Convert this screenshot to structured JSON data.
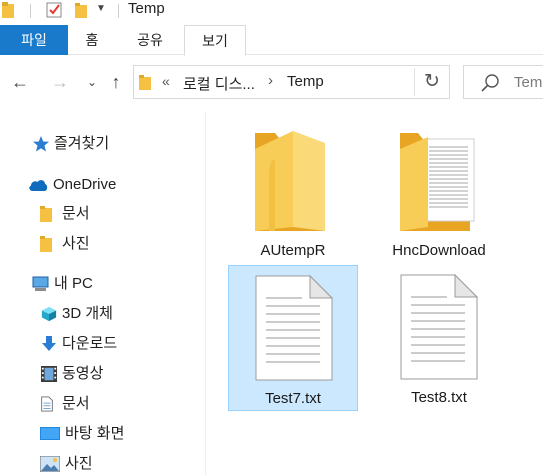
{
  "window": {
    "title": "Temp"
  },
  "ribbon": {
    "tabs": [
      {
        "label": "파일"
      },
      {
        "label": "홈"
      },
      {
        "label": "공유"
      },
      {
        "label": "보기"
      }
    ]
  },
  "nav": {
    "back_glyph": "←",
    "forward_glyph": "→",
    "recent_glyph": "⌄",
    "up_glyph": "↑",
    "address": {
      "overflow_glyph": "«",
      "crumbs": [
        "로컬 디스...",
        "Temp"
      ],
      "separator": "›"
    },
    "refresh_glyph": "↻",
    "search_placeholder": "Temp"
  },
  "sidebar": {
    "items": [
      {
        "label": "즐겨찾기",
        "icon": "star-icon"
      },
      {
        "label": "OneDrive",
        "icon": "cloud-icon"
      },
      {
        "label": "문서",
        "icon": "folder-icon"
      },
      {
        "label": "사진",
        "icon": "folder-icon"
      },
      {
        "label": "내 PC",
        "icon": "computer-icon"
      },
      {
        "label": "3D 개체",
        "icon": "cube-icon"
      },
      {
        "label": "다운로드",
        "icon": "download-icon"
      },
      {
        "label": "동영상",
        "icon": "film-icon"
      },
      {
        "label": "문서",
        "icon": "document-icon"
      },
      {
        "label": "바탕 화면",
        "icon": "desktop-icon"
      },
      {
        "label": "사진",
        "icon": "picture-icon"
      }
    ]
  },
  "files": [
    {
      "name": "AUtempR",
      "kind": "folder",
      "selected": false
    },
    {
      "name": "HncDownload",
      "kind": "folder-with-document",
      "selected": false
    },
    {
      "name": "Test7.txt",
      "kind": "text-file",
      "selected": true
    },
    {
      "name": "Test8.txt",
      "kind": "text-file",
      "selected": false
    }
  ],
  "colors": {
    "accent": "#1979ca",
    "folder": "#f5c142",
    "selection": "#cce8ff",
    "selection_border": "#99d1ff"
  }
}
